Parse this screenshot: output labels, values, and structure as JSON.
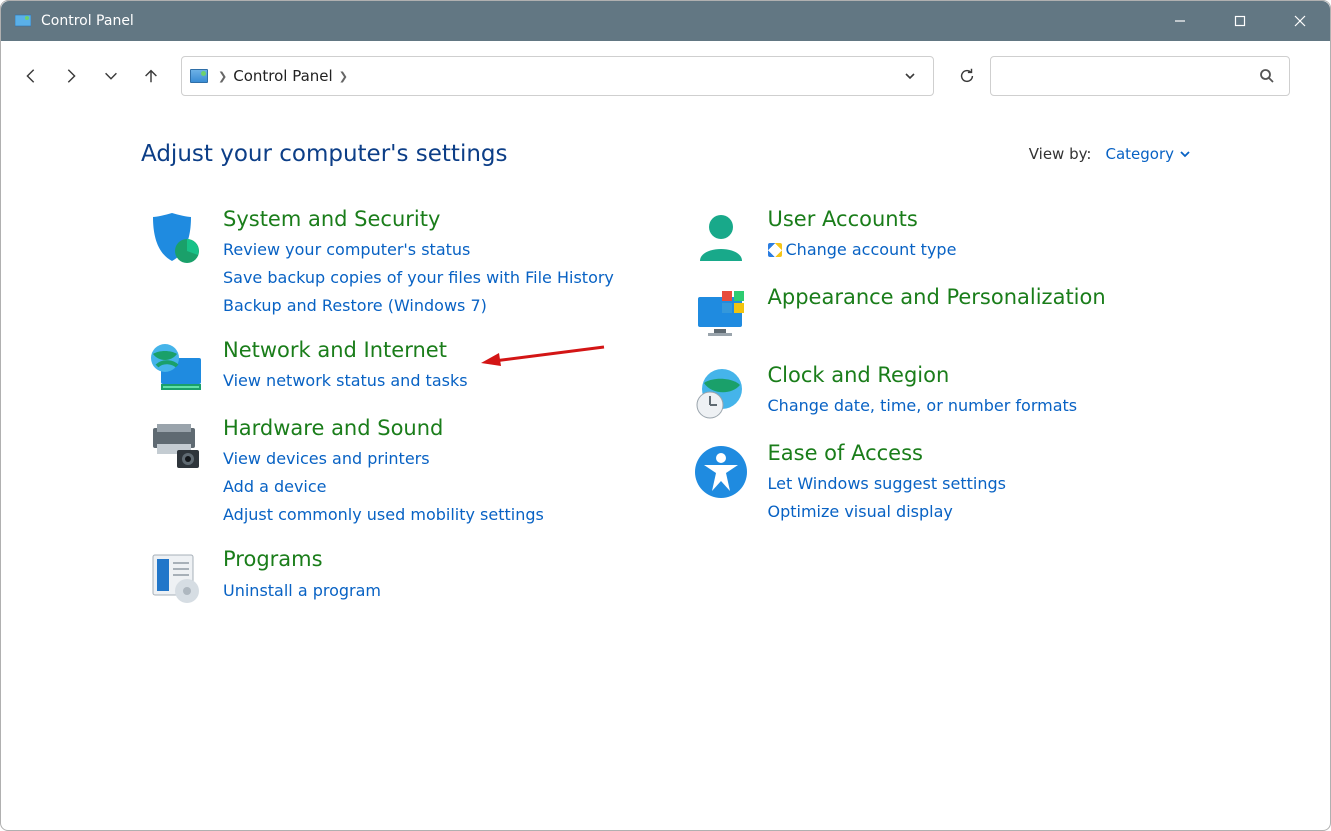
{
  "window": {
    "title": "Control Panel"
  },
  "address": {
    "crumb": "Control Panel"
  },
  "header": {
    "title": "Adjust your computer's settings"
  },
  "viewby": {
    "label": "View by:",
    "value": "Category"
  },
  "left": [
    {
      "title": "System and Security",
      "links": [
        "Review your computer's status",
        "Save backup copies of your files with File History",
        "Backup and Restore (Windows 7)"
      ]
    },
    {
      "title": "Network and Internet",
      "links": [
        "View network status and tasks"
      ]
    },
    {
      "title": "Hardware and Sound",
      "links": [
        "View devices and printers",
        "Add a device",
        "Adjust commonly used mobility settings"
      ]
    },
    {
      "title": "Programs",
      "links": [
        "Uninstall a program"
      ]
    }
  ],
  "right": [
    {
      "title": "User Accounts",
      "links": [
        "Change account type"
      ],
      "shield_links": [
        0
      ]
    },
    {
      "title": "Appearance and Personalization",
      "links": []
    },
    {
      "title": "Clock and Region",
      "links": [
        "Change date, time, or number formats"
      ]
    },
    {
      "title": "Ease of Access",
      "links": [
        "Let Windows suggest settings",
        "Optimize visual display"
      ]
    }
  ]
}
